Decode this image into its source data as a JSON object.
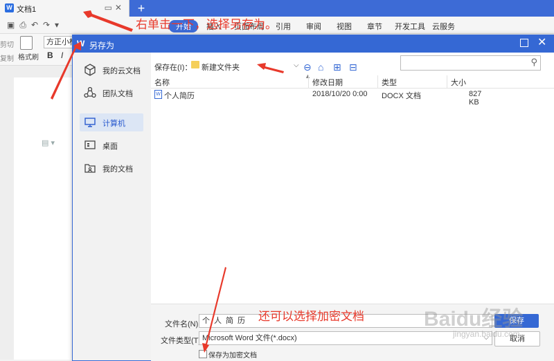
{
  "app": {
    "tab_title": "文档1",
    "new_tab": "+",
    "menu": [
      "开始",
      "插入",
      "页面布局",
      "引用",
      "审阅",
      "视图",
      "章节",
      "开发工具",
      "云服务"
    ],
    "ribbon": {
      "cut": "剪切",
      "copy": "复制",
      "format_brush": "格式刷",
      "font": "方正小标",
      "bold": "B",
      "italic": "I"
    }
  },
  "dialog": {
    "title": "另存为",
    "sidebar": [
      {
        "label": "我的云文档",
        "icon": "cube-icon"
      },
      {
        "label": "团队文档",
        "icon": "team-icon"
      },
      {
        "label": "计算机",
        "icon": "computer-icon",
        "active": true
      },
      {
        "label": "桌面",
        "icon": "desktop-icon"
      },
      {
        "label": "我的文档",
        "icon": "documents-icon"
      }
    ],
    "save_in_label": "保存在(I)：",
    "current_folder": "新建文件夹",
    "columns": [
      "名称",
      "修改日期",
      "类型",
      "大小"
    ],
    "files": [
      {
        "name": "个人简历",
        "modified": "2018/10/20 0:00",
        "type": "DOCX 文档",
        "size": "827 KB"
      }
    ],
    "filename_label": "文件名(N)：",
    "filename_value": "个人简历",
    "filetype_label": "文件类型(T)：",
    "filetype_value": "Microsoft Word 文件(*.docx)",
    "save_button": "保存",
    "cancel_button": "取消",
    "encrypt_label": "保存为加密文档"
  },
  "annotations": {
    "top": "右单击一下，选择另存为。",
    "bottom": "还可以选择加密文档"
  },
  "watermark": {
    "main": "Baidu经验",
    "sub": "jingyan.baidu.com"
  },
  "colors": {
    "accent": "#3568d4",
    "annotation": "#e8392b"
  }
}
